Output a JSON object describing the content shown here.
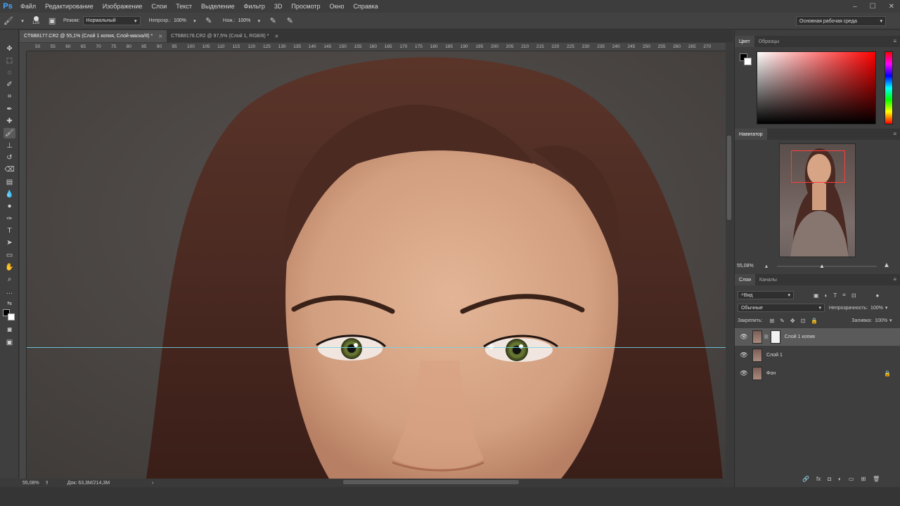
{
  "app": {
    "logo": "Ps"
  },
  "menu": [
    "Файл",
    "Редактирование",
    "Изображение",
    "Слои",
    "Текст",
    "Выделение",
    "Фильтр",
    "3D",
    "Просмотр",
    "Окно",
    "Справка"
  ],
  "window_controls": [
    "–",
    "☐",
    "✕"
  ],
  "options": {
    "brush_size": "125",
    "mode_label": "Режим:",
    "mode_value": "Нормальный",
    "opacity_label": "Непрозр.:",
    "opacity_value": "100%",
    "flow_label": "Наж.:",
    "flow_value": "100%",
    "workspace": "Основная рабочая среда"
  },
  "tabs": [
    {
      "title": "CT6B8177.CR2 @ 55,1% (Слой 1 копия, Слой-маска/8) *",
      "close": "✕"
    },
    {
      "title": "CT6B8178.CR2 @ 97,5% (Слой 1, RGB/8) *",
      "close": "✕"
    }
  ],
  "ruler_ticks": [
    "50",
    "55",
    "60",
    "65",
    "70",
    "75",
    "80",
    "85",
    "90",
    "95",
    "100",
    "105",
    "110",
    "115",
    "120",
    "125",
    "130",
    "135",
    "140",
    "145",
    "150",
    "155",
    "160",
    "165",
    "170",
    "175",
    "180",
    "185",
    "190",
    "195",
    "200",
    "205",
    "210",
    "215",
    "220",
    "225",
    "230",
    "235",
    "240",
    "245",
    "250",
    "255",
    "260",
    "265",
    "270"
  ],
  "status": {
    "zoom": "55,08%",
    "doc": "Док: 63,3M/214,3M",
    "arrow": "›"
  },
  "color_panel": {
    "tabs": [
      "Цвет",
      "Образцы"
    ]
  },
  "navigator": {
    "title": "Навигатор",
    "zoom": "55,08%"
  },
  "layers_panel": {
    "tabs": [
      "Слои",
      "Каналы"
    ],
    "filter": "Вид",
    "blend_mode": "Обычные",
    "opacity_label": "Непрозрачность:",
    "opacity_value": "100%",
    "lock_label": "Закрепить:",
    "fill_label": "Заливка:",
    "fill_value": "100%",
    "layers": [
      {
        "name": "Слой 1 копия",
        "selected": true,
        "mask": true,
        "locked": false
      },
      {
        "name": "Слой 1",
        "selected": false,
        "mask": false,
        "locked": false
      },
      {
        "name": "Фон",
        "selected": false,
        "mask": false,
        "locked": true
      }
    ],
    "bottom_icons": [
      "🔗",
      "fx",
      "◘",
      "◐",
      "▭",
      "⊞",
      "🗑"
    ]
  },
  "colors": {
    "accent": "#4aa8ff",
    "guide": "#6fd6e8",
    "nav_frame": "#ff3b3b",
    "panel_bg": "#3e3e3e"
  }
}
